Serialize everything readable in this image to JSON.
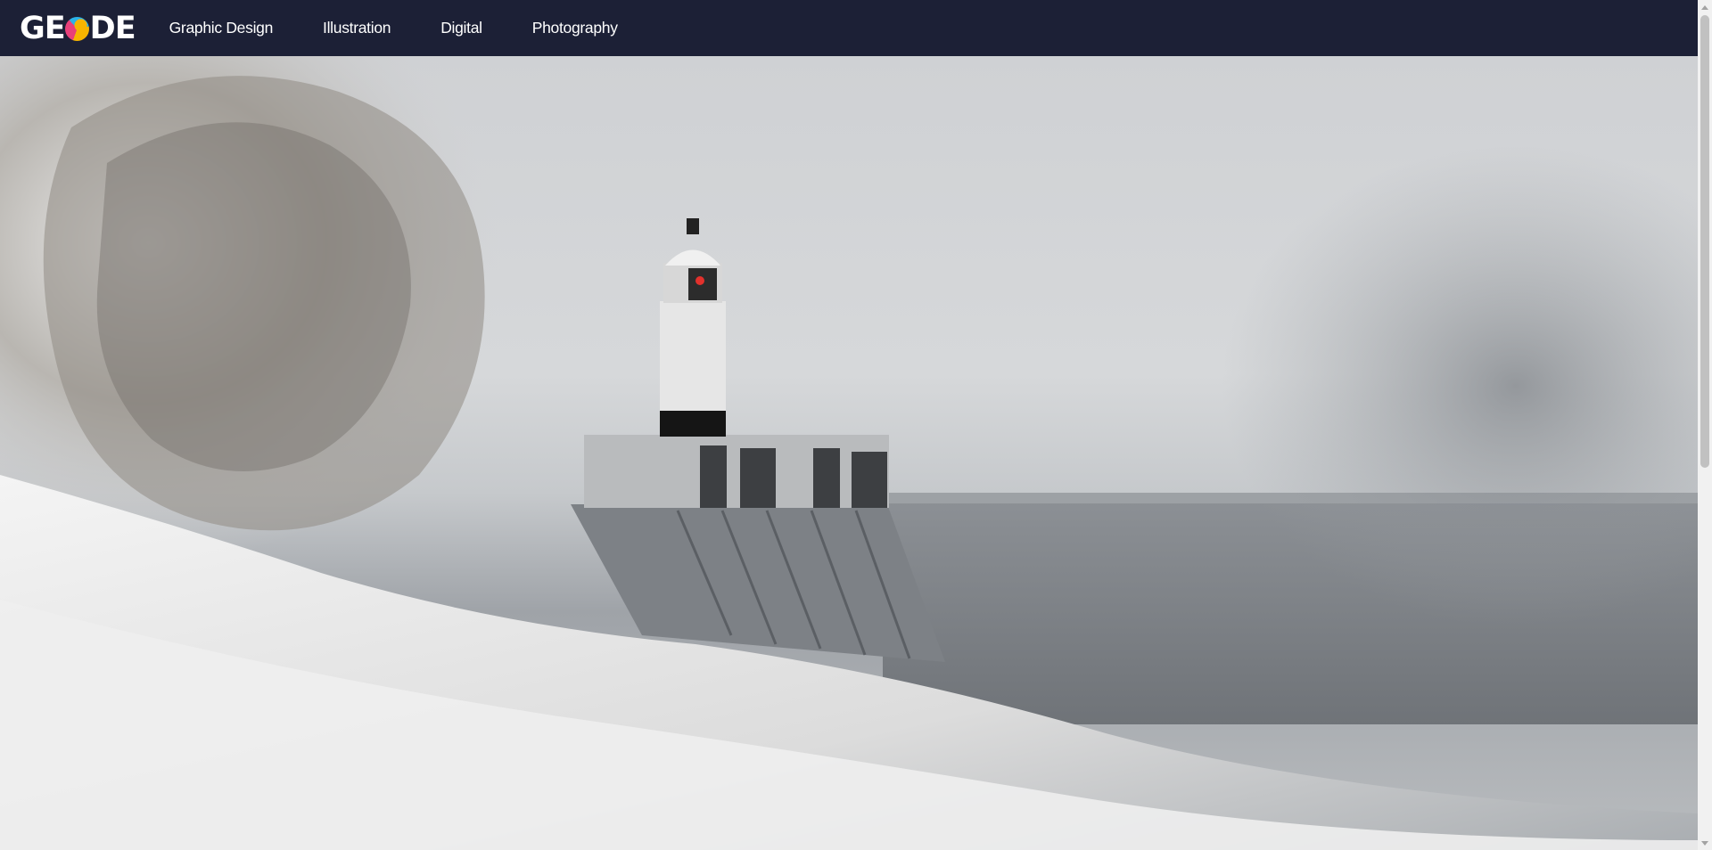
{
  "header": {
    "logo": {
      "letters_left": "GE",
      "letters_right": "DE",
      "colors": [
        "#e9407a",
        "#2bb3e8",
        "#f7b500"
      ]
    },
    "background": "#1c2036",
    "nav": [
      {
        "label": "Graphic Design"
      },
      {
        "label": "Illustration"
      },
      {
        "label": "Digital"
      },
      {
        "label": "Photography"
      }
    ]
  },
  "hero": {
    "image_subject": "lighthouse-storm-wave",
    "palette": [
      "#cfd1d4",
      "#8e9297",
      "#f2f2f2",
      "#1a1a1a"
    ]
  },
  "scrollbar": {
    "position_fraction": 0.0,
    "visible_fraction": 0.53
  }
}
